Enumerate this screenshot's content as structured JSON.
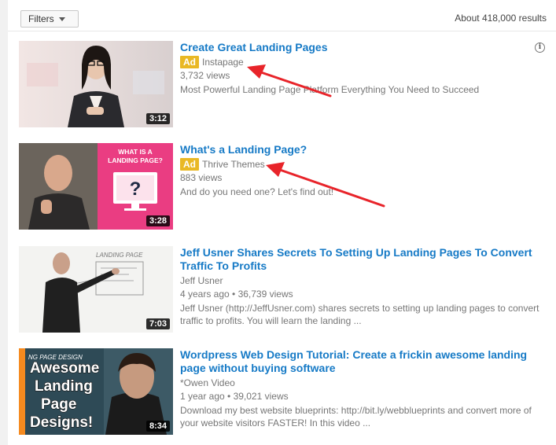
{
  "toolbar": {
    "filters_label": "Filters",
    "results_count": "About 418,000 results"
  },
  "results": [
    {
      "title": "Create Great Landing Pages",
      "ad_label": "Ad",
      "channel": "Instapage",
      "stats": "3,732 views",
      "description": "Most Powerful Landing Page Platform Everything You Need to Succeed",
      "duration": "3:12"
    },
    {
      "title": "What's a Landing Page?",
      "ad_label": "Ad",
      "channel": "Thrive Themes",
      "stats": "883 views",
      "description": "And do you need one? Let's find out!",
      "duration": "3:28",
      "thumb_text": "WHAT IS A LANDING PAGE?"
    },
    {
      "title": "Jeff Usner Shares Secrets To Setting Up Landing Pages To Convert Traffic To Profits",
      "channel": "Jeff Usner",
      "stats": "4 years ago • 36,739 views",
      "description": "Jeff Usner (http://JeffUsner.com) shares secrets to setting up landing pages to convert traffic to profits. You will learn the landing ...",
      "duration": "7:03",
      "thumb_text": "LANDING PAGE"
    },
    {
      "title": "Wordpress Web Design Tutorial: Create a frickin awesome landing page without buying software",
      "channel": "*Owen Video",
      "stats": "1 year ago • 39,021 views",
      "description": "Download my best website blueprints: http://bit.ly/webblueprints and convert more of your website visitors FASTER! In this video ...",
      "duration": "8:34",
      "thumb_text": "Awesome Landing Page Designs!",
      "thumb_top_text": "NG PAGE DESIGN"
    }
  ],
  "colors": {
    "title_link": "#167ac6",
    "ad_badge": "#e9b825",
    "annotation_arrow": "#e8242a"
  }
}
